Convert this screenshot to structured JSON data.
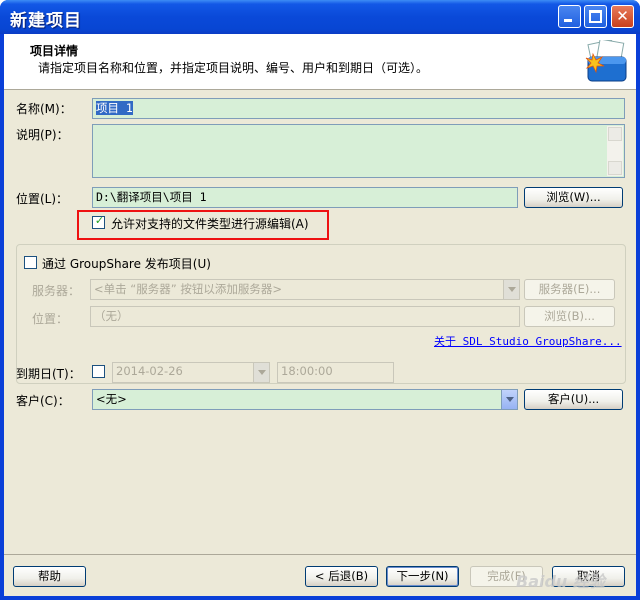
{
  "window": {
    "title": "新建项目"
  },
  "header": {
    "title": "项目详情",
    "subtitle": "请指定项目名称和位置，并指定项目说明、编号、用户和到期日（可选）。"
  },
  "form": {
    "name_label": "名称(M)：",
    "name_value": "项目 1",
    "desc_label": "说明(P)：",
    "location_label": "位置(L)：",
    "location_value": "D:\\翻译项目\\项目 1",
    "browse_button": "浏览(W)...",
    "allow_source_edit_label": "允许对支持的文件类型进行源编辑(A)",
    "allow_source_edit_checked": true
  },
  "groupshare": {
    "publish_label": "通过 GroupShare 发布项目(U)",
    "publish_checked": false,
    "server_label": "服务器：",
    "server_placeholder": "<单击 “服务器” 按钮以添加服务器>",
    "servers_button": "服务器(E)...",
    "location_label": "位置：",
    "location_value": "（无）",
    "browse_button": "浏览(B)...",
    "about_link": "关于 SDL Studio GroupShare..."
  },
  "due": {
    "label": "到期日(T)：",
    "checked": false,
    "date_value": "2014-02-26",
    "time_value": "18:00:00"
  },
  "customer": {
    "label": "客户(C)：",
    "value": "<无>",
    "button": "客户(U)..."
  },
  "footer": {
    "help": "帮助",
    "back": "< 后退(B)",
    "next": "下一步(N)",
    "finish": "完成(F)",
    "cancel": "取消"
  },
  "watermark_text": "Baidu 经验",
  "icons": {
    "header": "project-briefcase-icon",
    "check": "checkmark-icon",
    "dropdown": "chevron-down-icon"
  }
}
